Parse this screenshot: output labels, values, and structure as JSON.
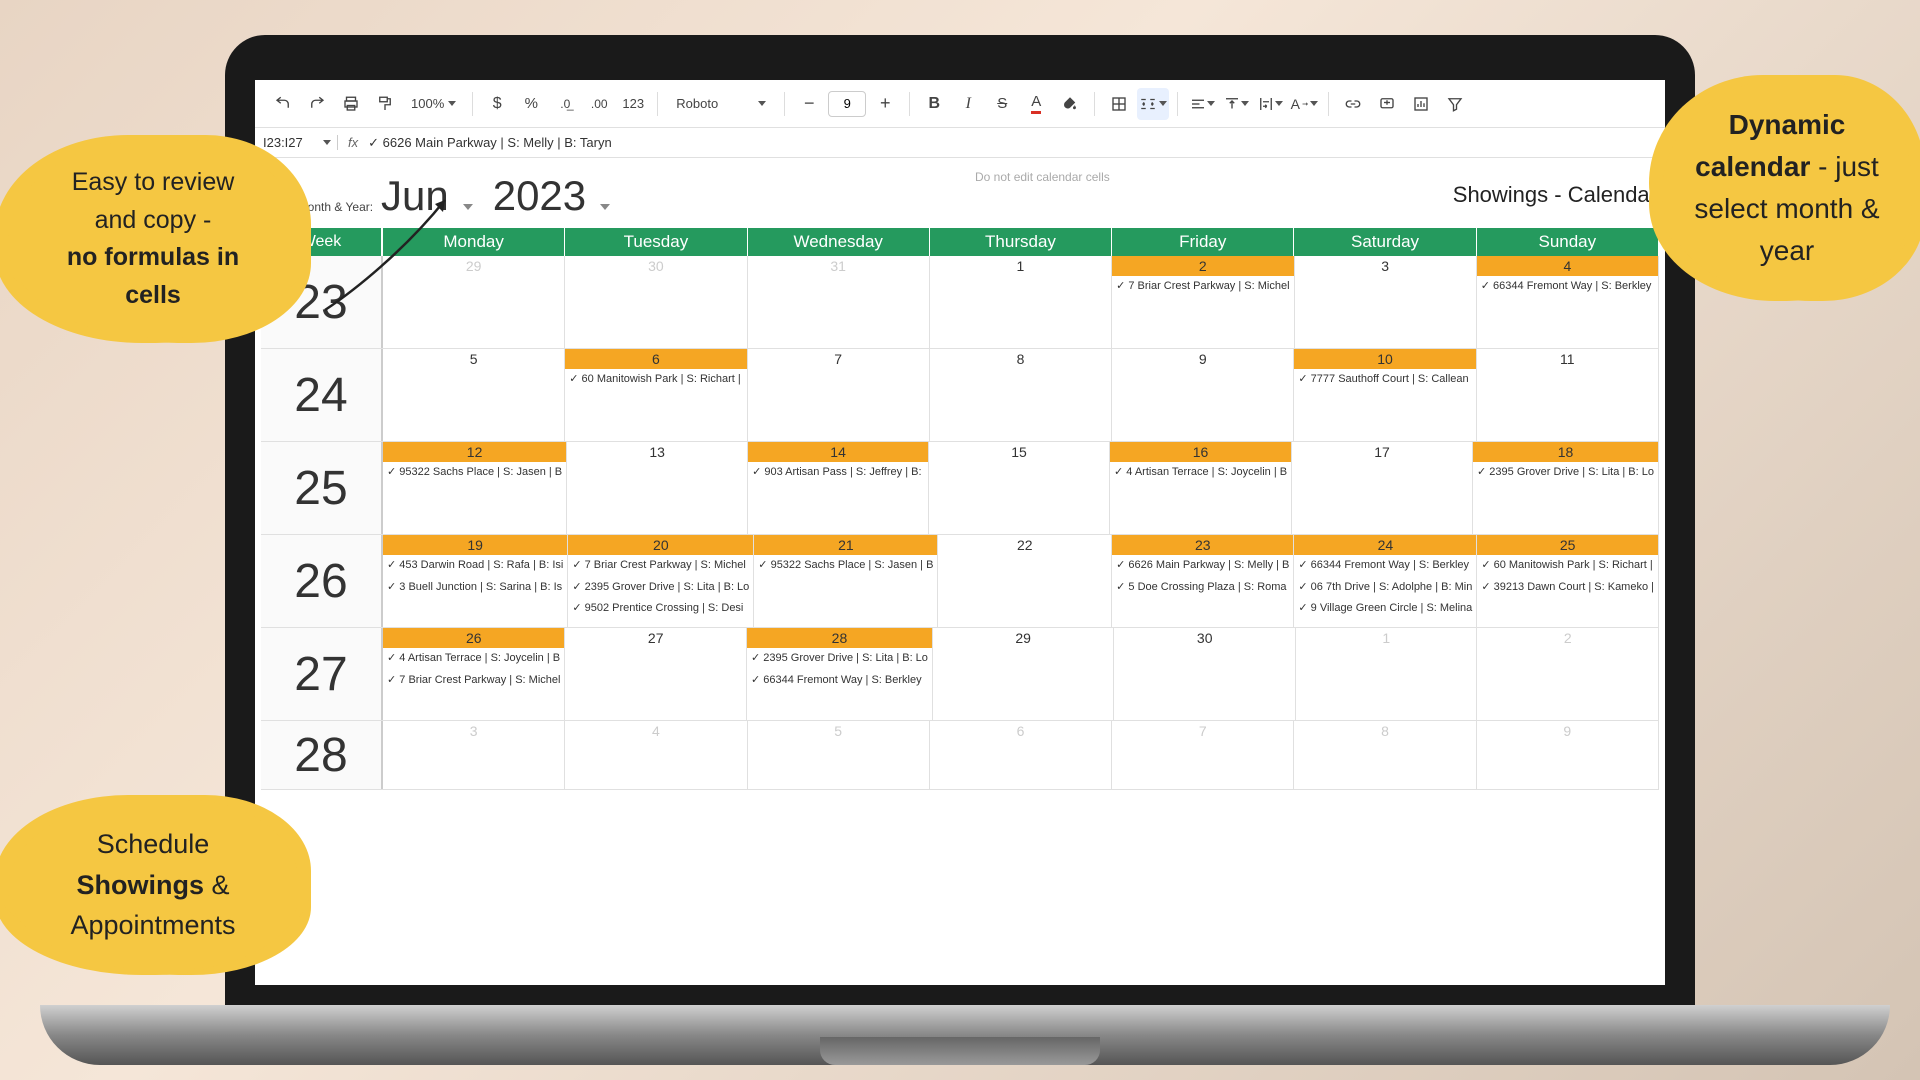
{
  "toolbar": {
    "zoom": "100%",
    "font": "Roboto",
    "font_size": "9"
  },
  "formula": {
    "name_box": "I23:I27",
    "fx_label": "fx",
    "content": "✓ 6626 Main Parkway | S: Melly | B: Taryn"
  },
  "controls": {
    "prompt": "Select month & Year:",
    "month": "Jun",
    "year": "2023",
    "no_edit": "Do not edit calendar cells",
    "title": "Showings - Calendar"
  },
  "headers": {
    "week": "Week",
    "days": [
      "Monday",
      "Tuesday",
      "Wednesday",
      "Thursday",
      "Friday",
      "Saturday",
      "Sunday"
    ]
  },
  "weeks": [
    {
      "num": "23",
      "cells": [
        {
          "d": "29",
          "faded": true,
          "hl": false,
          "ev": []
        },
        {
          "d": "30",
          "faded": true,
          "hl": false,
          "ev": []
        },
        {
          "d": "31",
          "faded": true,
          "hl": false,
          "ev": []
        },
        {
          "d": "1",
          "faded": false,
          "hl": false,
          "ev": []
        },
        {
          "d": "2",
          "faded": false,
          "hl": true,
          "ev": [
            "✓ 7 Briar Crest Parkway | S: Michel"
          ]
        },
        {
          "d": "3",
          "faded": false,
          "hl": false,
          "ev": []
        },
        {
          "d": "4",
          "faded": false,
          "hl": true,
          "ev": [
            "✓ 66344 Fremont Way | S: Berkley"
          ]
        }
      ]
    },
    {
      "num": "24",
      "cells": [
        {
          "d": "5",
          "faded": false,
          "hl": false,
          "ev": []
        },
        {
          "d": "6",
          "faded": false,
          "hl": true,
          "ev": [
            "✓ 60 Manitowish Park | S: Richart |"
          ]
        },
        {
          "d": "7",
          "faded": false,
          "hl": false,
          "ev": []
        },
        {
          "d": "8",
          "faded": false,
          "hl": false,
          "ev": []
        },
        {
          "d": "9",
          "faded": false,
          "hl": false,
          "ev": []
        },
        {
          "d": "10",
          "faded": false,
          "hl": true,
          "ev": [
            "✓ 7777 Sauthoff Court | S: Callean"
          ]
        },
        {
          "d": "11",
          "faded": false,
          "hl": false,
          "ev": []
        }
      ]
    },
    {
      "num": "25",
      "cells": [
        {
          "d": "12",
          "faded": false,
          "hl": true,
          "ev": [
            "✓ 95322 Sachs Place | S: Jasen | B"
          ]
        },
        {
          "d": "13",
          "faded": false,
          "hl": false,
          "ev": []
        },
        {
          "d": "14",
          "faded": false,
          "hl": true,
          "ev": [
            "✓ 903 Artisan Pass | S: Jeffrey | B:"
          ]
        },
        {
          "d": "15",
          "faded": false,
          "hl": false,
          "ev": []
        },
        {
          "d": "16",
          "faded": false,
          "hl": true,
          "ev": [
            "✓ 4 Artisan Terrace | S: Joycelin | B"
          ]
        },
        {
          "d": "17",
          "faded": false,
          "hl": false,
          "ev": []
        },
        {
          "d": "18",
          "faded": false,
          "hl": true,
          "ev": [
            "✓ 2395 Grover Drive | S: Lita | B: Lo"
          ]
        }
      ]
    },
    {
      "num": "26",
      "cells": [
        {
          "d": "19",
          "faded": false,
          "hl": true,
          "ev": [
            "✓ 453 Darwin Road | S: Rafa | B: Isi",
            "✓ 3 Buell Junction | S: Sarina | B: Is"
          ]
        },
        {
          "d": "20",
          "faded": false,
          "hl": true,
          "ev": [
            "✓ 7 Briar Crest Parkway | S: Michel",
            "✓ 2395 Grover Drive | S: Lita | B: Lo",
            "✓ 9502 Prentice Crossing | S: Desi"
          ]
        },
        {
          "d": "21",
          "faded": false,
          "hl": true,
          "ev": [
            "✓ 95322 Sachs Place | S: Jasen | B"
          ]
        },
        {
          "d": "22",
          "faded": false,
          "hl": false,
          "ev": []
        },
        {
          "d": "23",
          "faded": false,
          "hl": true,
          "ev": [
            "✓ 6626 Main Parkway | S: Melly | B",
            "✓ 5 Doe Crossing Plaza | S: Roma"
          ]
        },
        {
          "d": "24",
          "faded": false,
          "hl": true,
          "ev": [
            "✓ 66344 Fremont Way | S: Berkley",
            "✓ 06 7th Drive | S: Adolphe | B: Min",
            "✓ 9 Village Green Circle | S: Melina"
          ]
        },
        {
          "d": "25",
          "faded": false,
          "hl": true,
          "ev": [
            "✓ 60 Manitowish Park | S: Richart |",
            "✓ 39213 Dawn Court | S: Kameko |"
          ]
        }
      ]
    },
    {
      "num": "27",
      "cells": [
        {
          "d": "26",
          "faded": false,
          "hl": true,
          "ev": [
            "✓ 4 Artisan Terrace | S: Joycelin | B",
            "✓ 7 Briar Crest Parkway | S: Michel"
          ]
        },
        {
          "d": "27",
          "faded": false,
          "hl": false,
          "ev": []
        },
        {
          "d": "28",
          "faded": false,
          "hl": true,
          "ev": [
            "✓ 2395 Grover Drive | S: Lita | B: Lo",
            "✓ 66344 Fremont Way | S: Berkley"
          ]
        },
        {
          "d": "29",
          "faded": false,
          "hl": false,
          "ev": []
        },
        {
          "d": "30",
          "faded": false,
          "hl": false,
          "ev": []
        },
        {
          "d": "1",
          "faded": true,
          "hl": false,
          "ev": []
        },
        {
          "d": "2",
          "faded": true,
          "hl": false,
          "ev": []
        }
      ]
    },
    {
      "num": "28",
      "short": true,
      "cells": [
        {
          "d": "3",
          "faded": true,
          "hl": false,
          "ev": []
        },
        {
          "d": "4",
          "faded": true,
          "hl": false,
          "ev": []
        },
        {
          "d": "5",
          "faded": true,
          "hl": false,
          "ev": []
        },
        {
          "d": "6",
          "faded": true,
          "hl": false,
          "ev": []
        },
        {
          "d": "7",
          "faded": true,
          "hl": false,
          "ev": []
        },
        {
          "d": "8",
          "faded": true,
          "hl": false,
          "ev": []
        },
        {
          "d": "9",
          "faded": true,
          "hl": false,
          "ev": []
        }
      ]
    }
  ],
  "bubbles": {
    "b1_line1": "Easy to review",
    "b1_line2": "and copy -",
    "b1_line3": "no formulas in",
    "b1_line4": "cells",
    "b2_line1": "Schedule",
    "b2_line2a": "Showings",
    "b2_line2b": " &",
    "b2_line3": "Appointments",
    "b3_line1": "Dynamic",
    "b3_line2a": "calendar",
    "b3_line2b": " - just",
    "b3_line3": "select month &",
    "b3_line4": "year"
  }
}
